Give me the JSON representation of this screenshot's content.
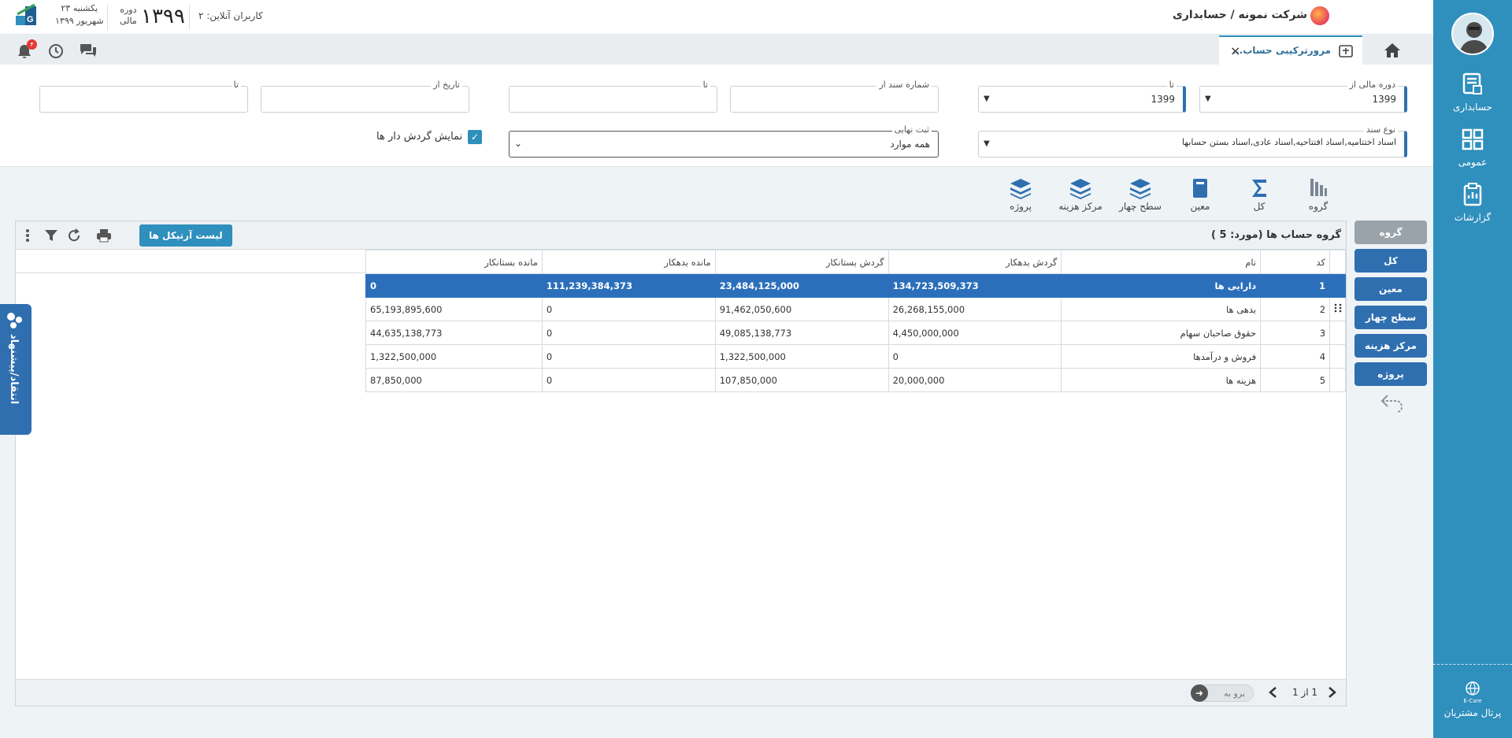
{
  "header": {
    "company": "شرکت نمونه / حسابداری",
    "online_users": "کاربران آنلاین: ۲",
    "fiscal_year": "۱۳۹۹",
    "period_label_1": "دوره",
    "period_label_2": "مالی",
    "date_line_1": "یکشنبه ۲۳",
    "date_line_2": "شهریور ۱۳۹۹"
  },
  "tab": {
    "title": "مرورترکیبی حساب..."
  },
  "notifications": {
    "count": "۴"
  },
  "sidebar": {
    "items": [
      {
        "label": "حسابداری",
        "icon": "accounting-icon"
      },
      {
        "label": "عمومی",
        "icon": "general-icon"
      },
      {
        "label": "گزارشات",
        "icon": "reports-icon"
      }
    ],
    "portal_label": "پرتال مشتریان",
    "portal_caption": "E-Care"
  },
  "filters": {
    "fiscal_from": {
      "label": "دوره مالی از",
      "value": "1399"
    },
    "fiscal_to": {
      "label": "تا",
      "value": "1399"
    },
    "doc_no_from": {
      "label": "شماره سند از",
      "value": ""
    },
    "doc_no_to": {
      "label": "تا",
      "value": ""
    },
    "date_from": {
      "label": "تاریخ از",
      "value": ""
    },
    "date_to": {
      "label": "تا",
      "value": ""
    },
    "doc_type": {
      "label": "نوع سند",
      "value": "اسناد اختتامیه,اسناد افتتاحیه,اسناد عادی,اسناد بستن حسابها"
    },
    "final_reg": {
      "label": "ثبت نهایی",
      "value": "همه موارد"
    },
    "show_turnover": {
      "label": "نمایش گردش دار ها",
      "checked": true
    }
  },
  "levels": [
    {
      "label": "گروه",
      "icon": "group-bars-icon"
    },
    {
      "label": "کل",
      "icon": "sigma-icon"
    },
    {
      "label": "معین",
      "icon": "book-icon"
    },
    {
      "label": "سطح چهار",
      "icon": "layers-icon"
    },
    {
      "label": "مرکز هزینه",
      "icon": "layers-icon"
    },
    {
      "label": "پروژه",
      "icon": "layers-icon"
    }
  ],
  "group_buttons": [
    {
      "label": "گروه",
      "active": true
    },
    {
      "label": "کل"
    },
    {
      "label": "معین"
    },
    {
      "label": "سطح چهار"
    },
    {
      "label": "مرکز هزینه"
    },
    {
      "label": "پروژه"
    }
  ],
  "grid": {
    "title": "گروه حساب ها (مورد:  5 )",
    "articles_button": "لیست آرتیکل ها",
    "columns": [
      "کد",
      "نام",
      "گردش بدهکار",
      "گردش بستانکار",
      "مانده بدهکار",
      "مانده بستانکار"
    ],
    "rows": [
      {
        "code": "1",
        "name": "دارایی ها",
        "debit_turnover": "134,723,509,373",
        "credit_turnover": "23,484,125,000",
        "debit_balance": "111,239,384,373",
        "credit_balance": "0"
      },
      {
        "code": "2",
        "name": "بدهی ها",
        "debit_turnover": "26,268,155,000",
        "credit_turnover": "91,462,050,600",
        "debit_balance": "0",
        "credit_balance": "65,193,895,600"
      },
      {
        "code": "3",
        "name": "حقوق صاحبان سهام",
        "debit_turnover": "4,450,000,000",
        "credit_turnover": "49,085,138,773",
        "debit_balance": "0",
        "credit_balance": "44,635,138,773"
      },
      {
        "code": "4",
        "name": "فروش و درآمدها",
        "debit_turnover": "0",
        "credit_turnover": "1,322,500,000",
        "debit_balance": "0",
        "credit_balance": "1,322,500,000"
      },
      {
        "code": "5",
        "name": "هزینه ها",
        "debit_turnover": "20,000,000",
        "credit_turnover": "107,850,000",
        "debit_balance": "0",
        "credit_balance": "87,850,000"
      }
    ]
  },
  "pager": {
    "text": "1 از 1",
    "goto_label": "برو به"
  },
  "feedback": {
    "label": "انتقاد/پیشنهاد"
  },
  "colors": {
    "sidebar": "#2f8fbd",
    "selected_row": "#2b6fbb",
    "button_blue": "#2f6fb0"
  }
}
